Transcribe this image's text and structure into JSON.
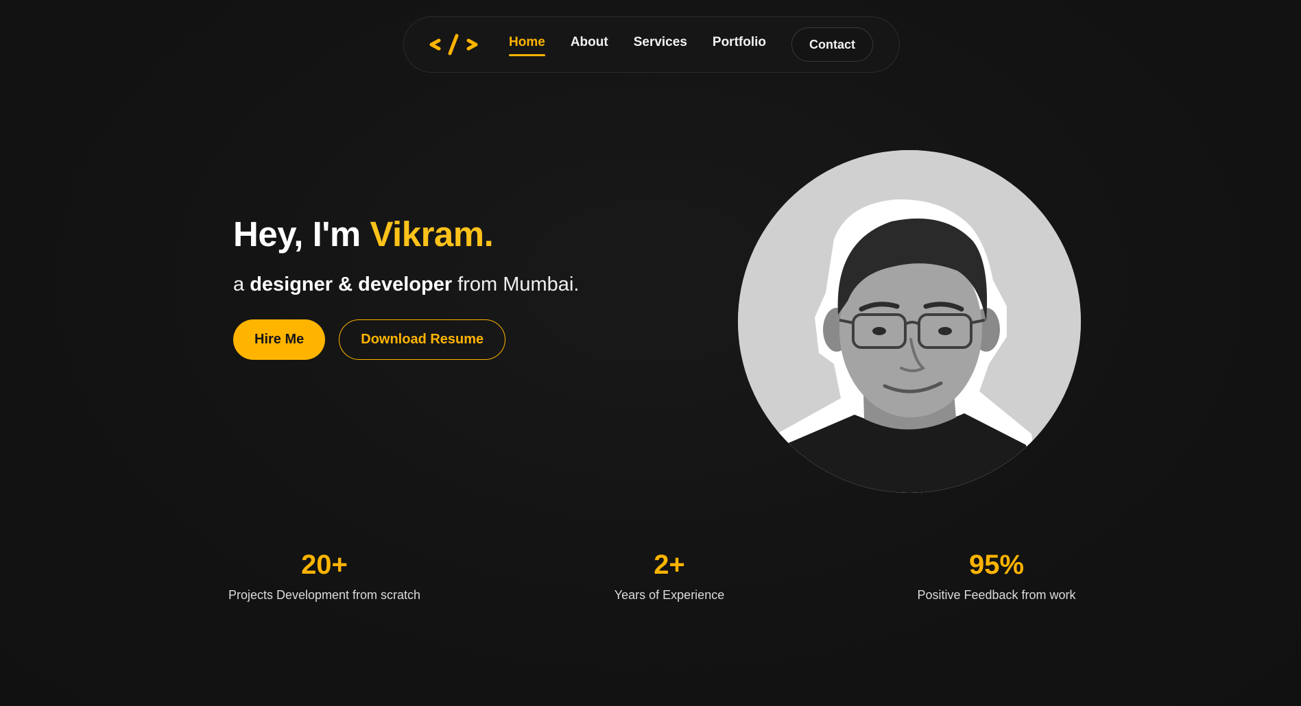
{
  "nav": {
    "logo_icon": "code-brackets-icon",
    "links": [
      {
        "label": "Home",
        "active": true
      },
      {
        "label": "About",
        "active": false
      },
      {
        "label": "Services",
        "active": false
      },
      {
        "label": "Portfolio",
        "active": false
      }
    ],
    "contact_label": "Contact"
  },
  "hero": {
    "greeting": "Hey, I'm ",
    "name": "Vikram.",
    "sub_prefix": "a ",
    "sub_role": "designer & developer",
    "sub_suffix": " from Mumbai.",
    "hire_label": "Hire Me",
    "resume_label": "Download Resume",
    "portrait_icon": "profile-photo"
  },
  "stats": [
    {
      "value": "20+",
      "label": "Projects Development from scratch"
    },
    {
      "value": "2+",
      "label": "Years of Experience"
    },
    {
      "value": "95%",
      "label": "Positive Feedback from work"
    }
  ],
  "colors": {
    "accent": "#ffb400",
    "name_accent": "#ffc21a",
    "background": "#131313"
  }
}
